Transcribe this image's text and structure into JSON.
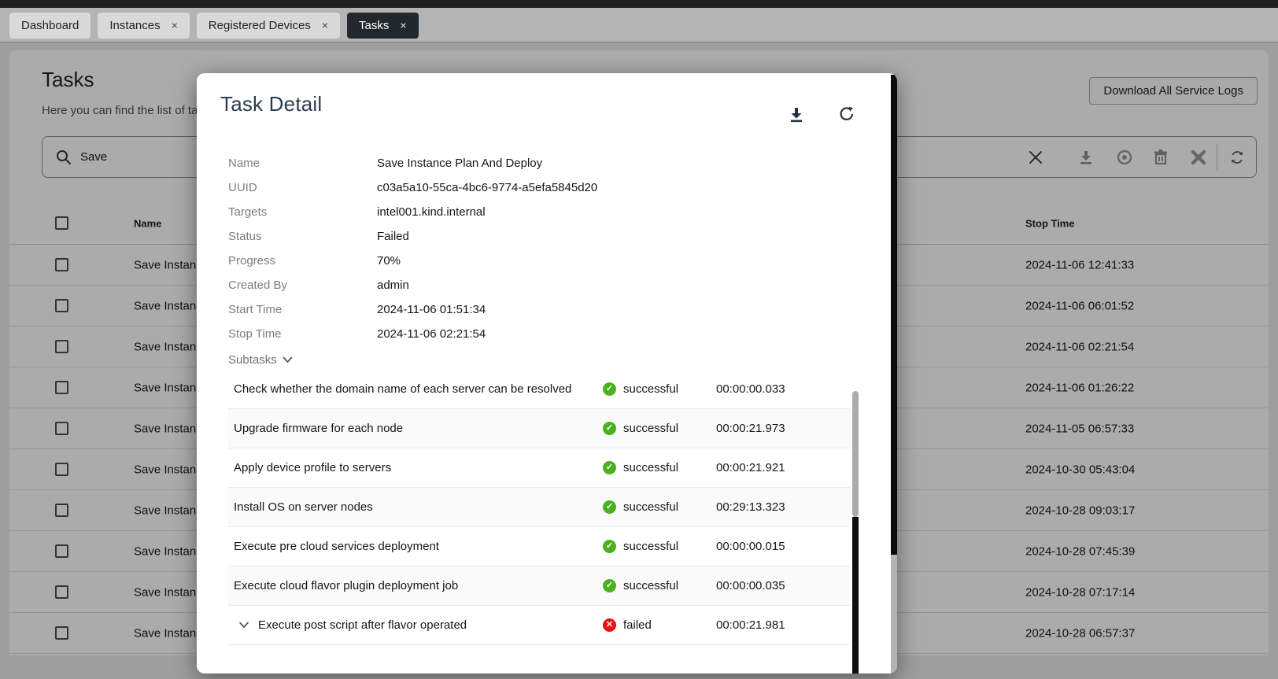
{
  "window": {
    "tabs": [
      {
        "label": "Dashboard",
        "closable": false,
        "active": false
      },
      {
        "label": "Instances",
        "closable": true,
        "active": false
      },
      {
        "label": "Registered Devices",
        "closable": true,
        "active": false
      },
      {
        "label": "Tasks",
        "closable": true,
        "active": true
      }
    ]
  },
  "page": {
    "title": "Tasks",
    "subtitle": "Here you can find the list of ta",
    "download_all_button": "Download All Service Logs",
    "search": {
      "value": "Save"
    },
    "toolbar_icons": [
      "clear-icon",
      "download-icon",
      "view-icon",
      "delete-icon",
      "cancel-icon",
      "refresh-icon"
    ]
  },
  "table": {
    "columns": {
      "name": "Name",
      "stop_time": "Stop Time"
    },
    "rows": [
      {
        "name": "Save Instanc",
        "stop_time": "2024-11-06 12:41:33"
      },
      {
        "name": "Save Instanc",
        "stop_time": "2024-11-06 06:01:52"
      },
      {
        "name": "Save Instanc",
        "stop_time": "2024-11-06 02:21:54"
      },
      {
        "name": "Save Instanc",
        "stop_time": "2024-11-06 01:26:22"
      },
      {
        "name": "Save Instanc",
        "stop_time": "2024-11-05 06:57:33"
      },
      {
        "name": "Save Instanc",
        "stop_time": "2024-10-30 05:43:04"
      },
      {
        "name": "Save Instanc",
        "stop_time": "2024-10-28 09:03:17"
      },
      {
        "name": "Save Instanc",
        "stop_time": "2024-10-28 07:45:39"
      },
      {
        "name": "Save Instanc",
        "stop_time": "2024-10-28 07:17:14"
      },
      {
        "name": "Save Instanc",
        "stop_time": "2024-10-28 06:57:37"
      }
    ]
  },
  "modal": {
    "title": "Task Detail",
    "header_icons": [
      "download-icon",
      "refresh-icon"
    ],
    "fields": [
      {
        "label": "Name",
        "value": "Save Instance Plan And Deploy"
      },
      {
        "label": "UUID",
        "value": "c03a5a10-55ca-4bc6-9774-a5efa5845d20"
      },
      {
        "label": "Targets",
        "value": "intel001.kind.internal"
      },
      {
        "label": "Status",
        "value": "Failed"
      },
      {
        "label": "Progress",
        "value": "70%"
      },
      {
        "label": "Created By",
        "value": "admin"
      },
      {
        "label": "Start Time",
        "value": "2024-11-06 01:51:34"
      },
      {
        "label": "Stop Time",
        "value": "2024-11-06 02:21:54"
      }
    ],
    "subtasks_label": "Subtasks",
    "subtasks": [
      {
        "name": "Check whether the domain name of each server can be resolved",
        "status": "successful",
        "duration": "00:00:00.033",
        "expandable": false
      },
      {
        "name": "Upgrade firmware for each node",
        "status": "successful",
        "duration": "00:00:21.973",
        "expandable": false
      },
      {
        "name": "Apply device profile to servers",
        "status": "successful",
        "duration": "00:00:21.921",
        "expandable": false
      },
      {
        "name": "Install OS on server nodes",
        "status": "successful",
        "duration": "00:29:13.323",
        "expandable": false
      },
      {
        "name": "Execute pre cloud services deployment",
        "status": "successful",
        "duration": "00:00:00.015",
        "expandable": false
      },
      {
        "name": "Execute cloud flavor plugin deployment job",
        "status": "successful",
        "duration": "00:00:00.035",
        "expandable": false
      },
      {
        "name": "Execute post script after flavor operated",
        "status": "failed",
        "duration": "00:00:21.981",
        "expandable": true
      }
    ]
  },
  "colors": {
    "success": "#4cb121",
    "failure": "#ee1111",
    "active_tab_bg": "#22272e",
    "modal_heading": "#2b3d4f"
  }
}
